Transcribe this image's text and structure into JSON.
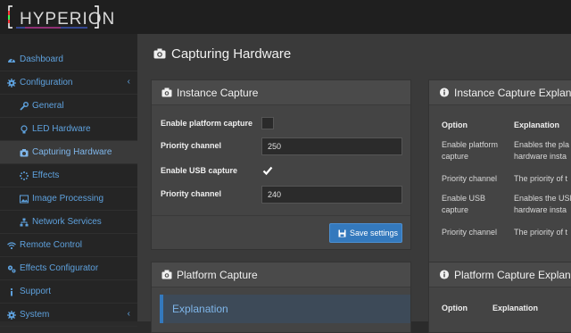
{
  "app": {
    "logo_text": "HYPERION"
  },
  "sidebar": {
    "items": [
      {
        "label": "Dashboard",
        "icon": "tachometer-icon"
      },
      {
        "label": "Configuration",
        "icon": "gear-icon",
        "chevron": "‹"
      },
      {
        "label": "General",
        "icon": "wrench-icon"
      },
      {
        "label": "LED Hardware",
        "icon": "lightbulb-icon"
      },
      {
        "label": "Capturing Hardware",
        "icon": "camera-icon"
      },
      {
        "label": "Effects",
        "icon": "spinner-icon"
      },
      {
        "label": "Image Processing",
        "icon": "image-icon"
      },
      {
        "label": "Network Services",
        "icon": "sitemap-icon"
      },
      {
        "label": "Remote Control",
        "icon": "wifi-icon"
      },
      {
        "label": "Effects Configurator",
        "icon": "gears-icon"
      },
      {
        "label": "Support",
        "icon": "info-icon"
      },
      {
        "label": "System",
        "icon": "gear-icon",
        "chevron": "‹"
      }
    ]
  },
  "page": {
    "title": "Capturing Hardware"
  },
  "instance_capture": {
    "title": "Instance Capture",
    "fields": [
      {
        "label": "Enable platform capture",
        "type": "checkbox",
        "checked": false
      },
      {
        "label": "Priority channel",
        "type": "input",
        "value": "250"
      },
      {
        "label": "Enable USB capture",
        "type": "checkbox",
        "checked": true
      },
      {
        "label": "Priority channel",
        "type": "input",
        "value": "240"
      }
    ],
    "save_label": "Save settings"
  },
  "instance_explain": {
    "title": "Instance Capture Explanatio",
    "col_option": "Option",
    "col_explanation": "Explanation",
    "rows": [
      {
        "option": "Enable platform capture",
        "explanation": "Enables the pla hardware insta"
      },
      {
        "option": "Priority channel",
        "explanation": "The priority of t"
      },
      {
        "option": "Enable USB capture",
        "explanation": "Enables the USB hardware insta"
      },
      {
        "option": "Priority channel",
        "explanation": "The priority of t"
      }
    ]
  },
  "platform_capture": {
    "title": "Platform Capture",
    "explanation_label": "Explanation"
  },
  "platform_explain": {
    "title": "Platform Capture Explanati",
    "col_option": "Option",
    "col_explanation": "Explanation"
  },
  "colors": {
    "accent": "#3479bd",
    "link": "#5ea1dd"
  }
}
